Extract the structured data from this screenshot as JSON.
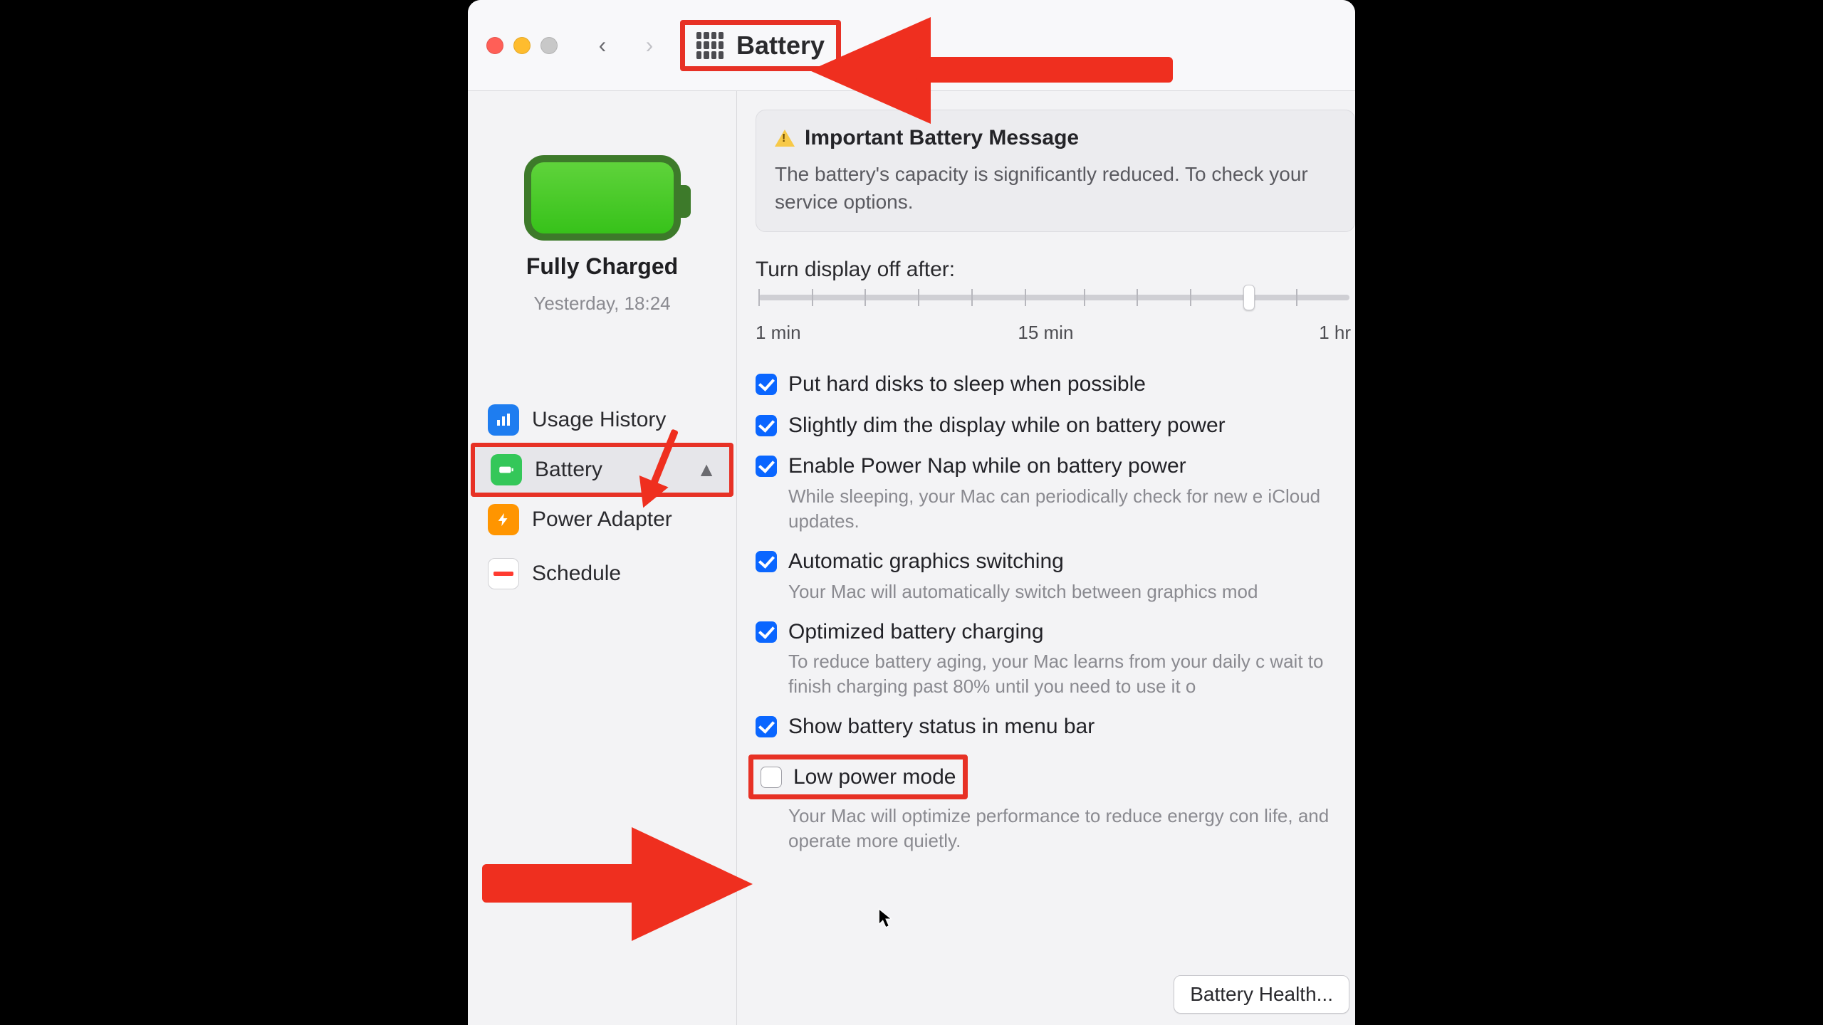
{
  "toolbar": {
    "title": "Battery"
  },
  "sidebar": {
    "status_title": "Fully Charged",
    "status_sub": "Yesterday, 18:24",
    "items": [
      {
        "label": "Usage History"
      },
      {
        "label": "Battery"
      },
      {
        "label": "Power Adapter"
      },
      {
        "label": "Schedule"
      }
    ]
  },
  "banner": {
    "title": "Important Battery Message",
    "body": "The battery's capacity is significantly reduced. To check your service options."
  },
  "display_off": {
    "label": "Turn display off after:",
    "ticks": [
      "1 min",
      "15 min",
      "1 hr"
    ]
  },
  "options": [
    {
      "label": "Put hard disks to sleep when possible",
      "checked": true
    },
    {
      "label": "Slightly dim the display while on battery power",
      "checked": true
    },
    {
      "label": "Enable Power Nap while on battery power",
      "checked": true,
      "desc": "While sleeping, your Mac can periodically check for new e iCloud updates."
    },
    {
      "label": "Automatic graphics switching",
      "checked": true,
      "desc": "Your Mac will automatically switch between graphics mod"
    },
    {
      "label": "Optimized battery charging",
      "checked": true,
      "desc": "To reduce battery aging, your Mac learns from your daily c wait to finish charging past 80% until you need to use it o"
    },
    {
      "label": "Show battery status in menu bar",
      "checked": true
    },
    {
      "label": "Low power mode",
      "checked": false,
      "desc": "Your Mac will optimize performance to reduce energy con life, and operate more quietly."
    }
  ],
  "footer": {
    "battery_health": "Battery Health..."
  }
}
